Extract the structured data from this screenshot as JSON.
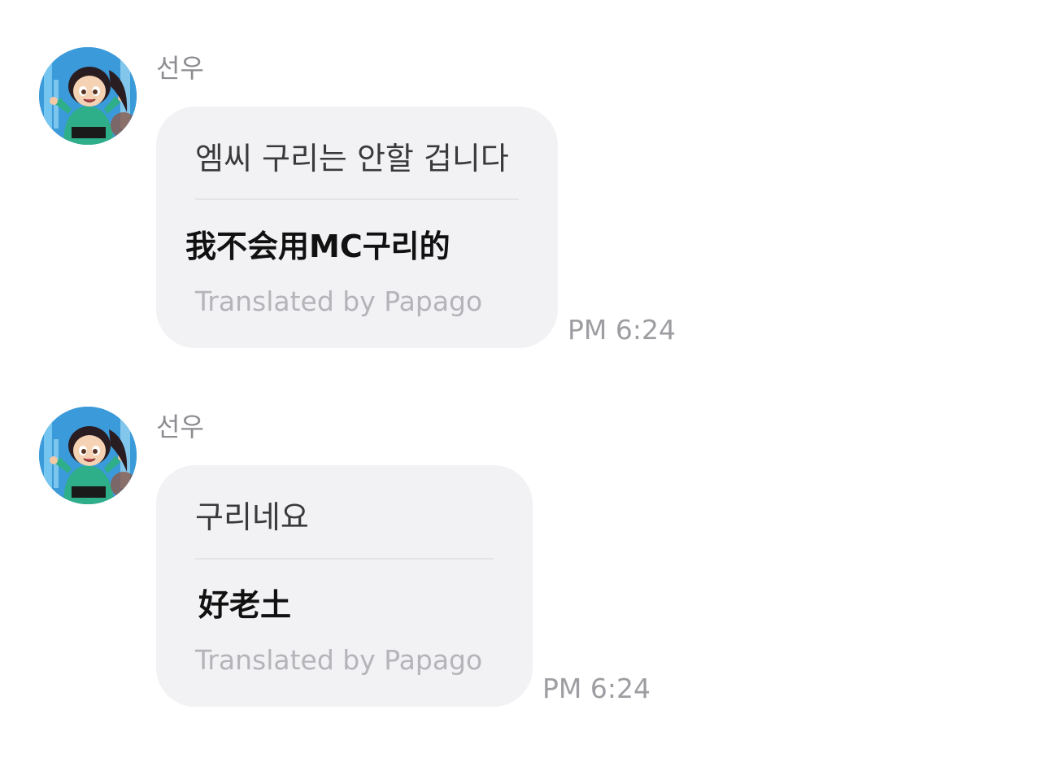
{
  "messages": [
    {
      "sender": "선우",
      "original": "엠씨 구리는 안할 겁니다",
      "translated": "我不会用MC구리的",
      "credit": "Translated by Papago",
      "time": "PM 6:24"
    },
    {
      "sender": "선우",
      "original": "구리네요",
      "translated": "好老土",
      "credit": "Translated by Papago",
      "time": "PM 6:24"
    }
  ],
  "colors": {
    "bubble": "#f2f2f5",
    "sender": "#8c8c91",
    "credit": "#b4b4b9",
    "time": "#9d9da2"
  },
  "icons": {
    "avatar": "profile-avatar-icon"
  }
}
